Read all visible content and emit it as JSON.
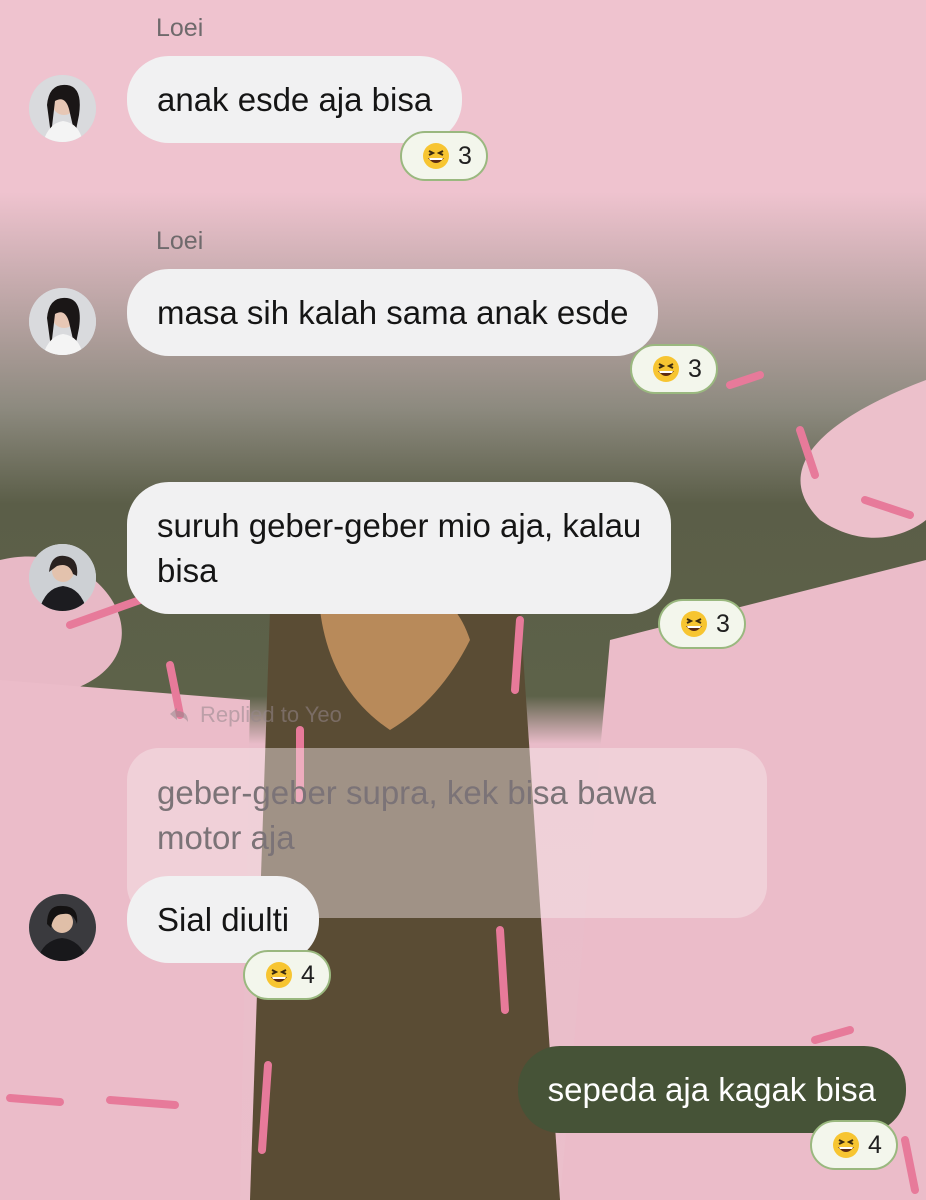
{
  "theme": {
    "bubble_other": "#f1f1f2",
    "bubble_mine": "#465337",
    "reaction_border": "#9ab87f",
    "background": "#efc3cf"
  },
  "messages": [
    {
      "sender": "Loei",
      "text": "anak esde aja bisa",
      "reaction": {
        "icon": "grinning-squinting-face-icon",
        "count": "3"
      }
    },
    {
      "sender": "Loei",
      "text": "masa sih kalah sama anak esde",
      "reaction": {
        "icon": "grinning-squinting-face-icon",
        "count": "3"
      }
    },
    {
      "sender": "",
      "text": "suruh geber-geber mio aja, kalau\nbisa",
      "reaction": {
        "icon": "grinning-squinting-face-icon",
        "count": "3"
      }
    },
    {
      "sender": "",
      "reply": {
        "label": "Replied to Yeo",
        "quote": "geber-geber supra, kek bisa bawa\nmotor aja"
      },
      "text": "Sial diulti",
      "reaction": {
        "icon": "grinning-squinting-face-icon",
        "count": "4"
      }
    },
    {
      "sender": "me",
      "text": "sepeda aja kagak bisa",
      "reaction": {
        "icon": "grinning-squinting-face-icon",
        "count": "4"
      }
    }
  ]
}
